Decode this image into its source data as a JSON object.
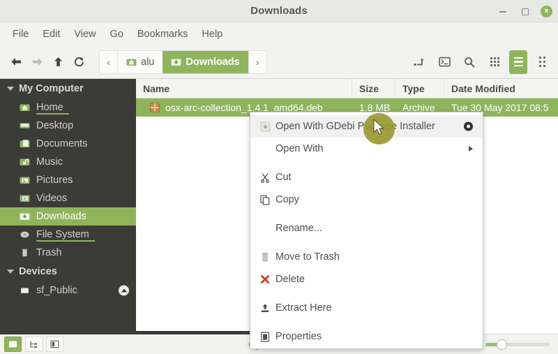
{
  "window": {
    "title": "Downloads",
    "controls": {
      "minimize": "minimize-button",
      "maximize": "maximize-button",
      "close": "×"
    }
  },
  "menubar": {
    "items": [
      "File",
      "Edit",
      "View",
      "Go",
      "Bookmarks",
      "Help"
    ]
  },
  "toolbar": {
    "nav": [
      {
        "name": "back-button",
        "icon": "arrow-left-icon",
        "enabled": true
      },
      {
        "name": "forward-button",
        "icon": "arrow-right-icon",
        "enabled": false
      },
      {
        "name": "up-button",
        "icon": "arrow-up-icon",
        "enabled": true
      },
      {
        "name": "reload-button",
        "icon": "reload-icon",
        "enabled": true
      }
    ],
    "breadcrumb": {
      "prev_arrow": "‹",
      "next_arrow": "›",
      "items": [
        {
          "label": "alu",
          "icon": "home-folder-icon",
          "active": false
        },
        {
          "label": "Downloads",
          "icon": "downloads-folder-icon",
          "active": true
        }
      ]
    },
    "right_buttons": [
      {
        "name": "open-in-new-tab-icon",
        "label": ""
      },
      {
        "name": "open-terminal-icon",
        "label": ""
      },
      {
        "name": "search-icon",
        "label": ""
      },
      {
        "name": "icon-view-icon",
        "label": ""
      },
      {
        "name": "list-view-icon",
        "label": "",
        "active": true
      },
      {
        "name": "compact-view-icon",
        "label": ""
      }
    ]
  },
  "sidebar": {
    "groups": [
      {
        "label": "My Computer",
        "name": "sidebar-group-my-computer",
        "items": [
          {
            "label": "Home",
            "icon": "home-folder-icon",
            "selected": false,
            "droptarget": true
          },
          {
            "label": "Desktop",
            "icon": "desktop-folder-icon",
            "selected": false,
            "droptarget": false
          },
          {
            "label": "Documents",
            "icon": "documents-folder-icon",
            "selected": false,
            "droptarget": false
          },
          {
            "label": "Music",
            "icon": "music-folder-icon",
            "selected": false,
            "droptarget": false
          },
          {
            "label": "Pictures",
            "icon": "pictures-folder-icon",
            "selected": false,
            "droptarget": false
          },
          {
            "label": "Videos",
            "icon": "videos-folder-icon",
            "selected": false,
            "droptarget": false
          },
          {
            "label": "Downloads",
            "icon": "downloads-folder-icon",
            "selected": true,
            "droptarget": false
          },
          {
            "label": "File System",
            "icon": "drive-icon",
            "selected": false,
            "droptarget": true
          },
          {
            "label": "Trash",
            "icon": "trash-icon",
            "selected": false,
            "droptarget": false
          }
        ]
      },
      {
        "label": "Devices",
        "name": "sidebar-group-devices",
        "items": [
          {
            "label": "sf_Public",
            "icon": "drive-icon",
            "selected": false,
            "droptarget": false,
            "eject": true
          }
        ]
      }
    ]
  },
  "filelist": {
    "columns": [
      "Name",
      "Size",
      "Type",
      "Date Modified"
    ],
    "rows": [
      {
        "name": "osx-arc-collection_1.4.1_amd64.deb",
        "size": "1.8 MB",
        "type": "Archive",
        "date": "Tue 30 May 2017 08:5",
        "icon": "package-archive-icon",
        "selected": true
      }
    ]
  },
  "context_menu": {
    "items": [
      {
        "label": "Open With GDebi Package Installer",
        "icon": "package-installer-icon",
        "highlight": true,
        "badge": "default-app-badge"
      },
      {
        "label": "Open With",
        "icon": null,
        "submenu": true
      },
      {
        "separator": true
      },
      {
        "label": "Cut",
        "icon": "scissors-icon"
      },
      {
        "label": "Copy",
        "icon": "copy-icon"
      },
      {
        "separator": true
      },
      {
        "label": "Rename...",
        "icon": null
      },
      {
        "separator": true
      },
      {
        "label": "Move to Trash",
        "icon": "trash-icon"
      },
      {
        "label": "Delete",
        "icon": "delete-x-icon"
      },
      {
        "separator": true
      },
      {
        "label": "Extract Here",
        "icon": "extract-icon"
      },
      {
        "separator": true
      },
      {
        "label": "Properties",
        "icon": "properties-icon"
      }
    ]
  },
  "statusbar": {
    "buttons": [
      {
        "name": "show-places-button",
        "glyph": "▰",
        "active": true
      },
      {
        "name": "show-treeview-button",
        "glyph": "⌸",
        "active": false
      },
      {
        "name": "toggle-sidebar-button",
        "glyph": "◧",
        "active": false
      }
    ],
    "text": "Open the sele",
    "zoom_value": 18
  },
  "colors": {
    "accent_green": "#8fb55c",
    "sidebar_bg": "#3b3b38",
    "toolbar_bg": "#f2f2f0",
    "click_halo": "#9a9a33"
  }
}
